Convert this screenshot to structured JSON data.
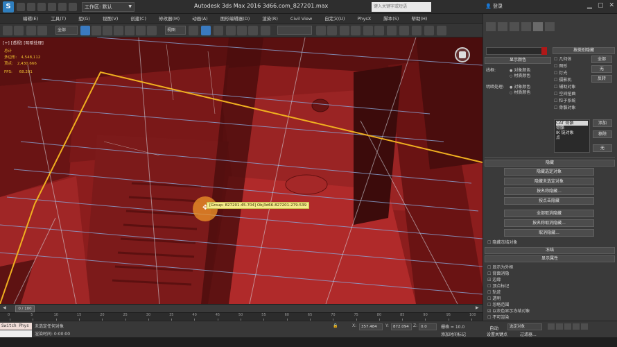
{
  "titlebar": {
    "workspace_label": "工作区: 默认",
    "window_title": "Autodesk 3ds Max 2016     3d66.com_827201.max",
    "search_placeholder": "键入关键字或短语",
    "login": "登录"
  },
  "menu": [
    "编辑(E)",
    "工具(T)",
    "组(G)",
    "视图(V)",
    "创建(C)",
    "修改器(M)",
    "动画(A)",
    "图形编辑器(D)",
    "渲染(R)",
    "Civil View",
    "自定义(U)",
    "PhysX",
    "脚本(S)",
    "帮助(H)"
  ],
  "toolbar": {
    "selection_filter": "全部",
    "ref_coord": "视图"
  },
  "viewport": {
    "label": "[+] [透视] [明暗处理]",
    "stats": {
      "header": "总计",
      "polys_label": "多边形:",
      "polys_value": "4,548,112",
      "verts_label": "顶点:",
      "verts_value": "2,430,666",
      "fps_label": "FPS:",
      "fps_value": "68.201"
    },
    "tooltip": "[Group: 827201-45-704] Obj3d66-827201-279-539"
  },
  "timeline": {
    "frame": "0 / 100",
    "ticks": [
      "0",
      "5",
      "10",
      "15",
      "20",
      "25",
      "30",
      "35",
      "40",
      "45",
      "50",
      "55",
      "60",
      "65",
      "70",
      "75",
      "80",
      "85",
      "90",
      "95",
      "100"
    ]
  },
  "status": {
    "maxscript": "Switch Phys",
    "line1": "未选定任何对象",
    "line2": "渲染时间: 0:00:00",
    "x_label": "X:",
    "x_value": "357.484",
    "y_label": "Y:",
    "y_value": "872.094",
    "z_label": "Z:",
    "z_value": "0.0",
    "grid": "栅格 = 10.0",
    "add_tag": "添加时间标记",
    "autokey": "自动",
    "key_sel": "选定对象",
    "setkey": "设置关键点",
    "key_filter": "过滤器..."
  },
  "command_panel": {
    "rollout_display_by_type": "按类别隐藏",
    "rollout_display_color": "显示颜色",
    "wireframe_label": "线框:",
    "shaded_label": "明暗处理:",
    "opt_object_color": "对象颜色",
    "opt_material_color": "材质颜色",
    "categories": [
      "几何体",
      "图形",
      "灯光",
      "摄影机",
      "辅助对象",
      "空间扭曲",
      "粒子系统",
      "骨骼对象"
    ],
    "btn_all": "全部",
    "btn_none": "无",
    "btn_invert": "反转",
    "listbox_items": [
      "CAT 骨骼",
      "骨骼",
      "IK 链对象",
      "点"
    ],
    "btn_add": "添加",
    "btn_remove": "移除",
    "btn_none2": "无",
    "rollout_hide": "隐藏",
    "hide_buttons": [
      "隐藏选定对象",
      "隐藏未选定对象",
      "按名称隐藏...",
      "按点击隐藏",
      "全部取消隐藏",
      "按名称取消隐藏...",
      "取消隐藏..."
    ],
    "hide_frozen": "隐藏冻结对象",
    "rollout_freeze": "冻结",
    "rollout_display_props": "显示属性",
    "display_props": [
      "显示为外框",
      "背面消隐",
      "边缘",
      "顶点标记",
      "轨迹",
      "透明",
      "忽略范围",
      "以灰色显示冻结对象",
      "不可渲染",
      "顶点颜色"
    ]
  }
}
